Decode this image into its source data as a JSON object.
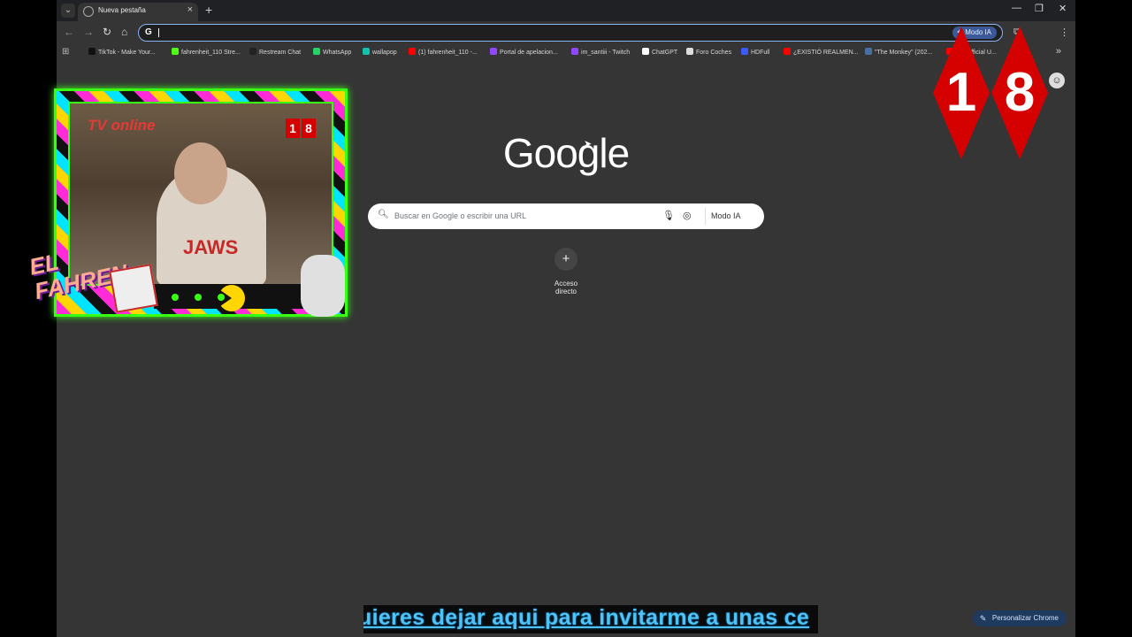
{
  "tab": {
    "title": "Nueva pestaña",
    "close": "×",
    "new": "+"
  },
  "window": {
    "minimize": "—",
    "restore": "❐",
    "close": "✕"
  },
  "toolbar": {
    "back": "←",
    "forward": "→",
    "reload": "↻",
    "home": "⌂",
    "omni_g": "G",
    "ai_mode": "Modo IA",
    "extensions": "⧉",
    "menu": "⋮"
  },
  "bookmarks": [
    {
      "label": "TikTok - Make Your...",
      "color": "#111111"
    },
    {
      "label": "fahrenheit_110 Stre...",
      "color": "#53fc18"
    },
    {
      "label": "Restream Chat",
      "color": "#222222"
    },
    {
      "label": "WhatsApp",
      "color": "#25d366"
    },
    {
      "label": "wallapop",
      "color": "#13c1ac"
    },
    {
      "label": "(1) fahrenheit_110 -...",
      "color": "#ff0000"
    },
    {
      "label": "Portal de apelacion...",
      "color": "#9146ff"
    },
    {
      "label": "im_santiii - Twitch",
      "color": "#9146ff"
    },
    {
      "label": "ChatGPT",
      "color": "#ffffff"
    },
    {
      "label": "Foro Coches",
      "color": "#dddddd"
    },
    {
      "label": "HDFull",
      "color": "#3d5afe"
    },
    {
      "label": "¿EXISTIÓ REALMEN...",
      "color": "#ff0000"
    },
    {
      "label": "\"The Monkey\" (202...",
      "color": "#4a6fa5"
    },
    {
      "label": "EN Official U...",
      "color": "#ff0000"
    }
  ],
  "bookmarks_more": "»",
  "ntp": {
    "logo": "Google",
    "search_placeholder": "Buscar en Google o escribir una URL",
    "search_ai": "Modo IA",
    "shortcut_plus": "+",
    "shortcut_label": "Acceso directo",
    "customize": "Personalizar Chrome"
  },
  "overlay": {
    "webcam_title": "TV online",
    "webcam_badge_1": "1",
    "webcam_badge_2": "8",
    "shirt": "JAWS",
    "fahren": "EL FAHREN",
    "big_1": "1",
    "big_8": "8",
    "ticker": "uieres dejar aqui para invitarme a unas ce"
  }
}
